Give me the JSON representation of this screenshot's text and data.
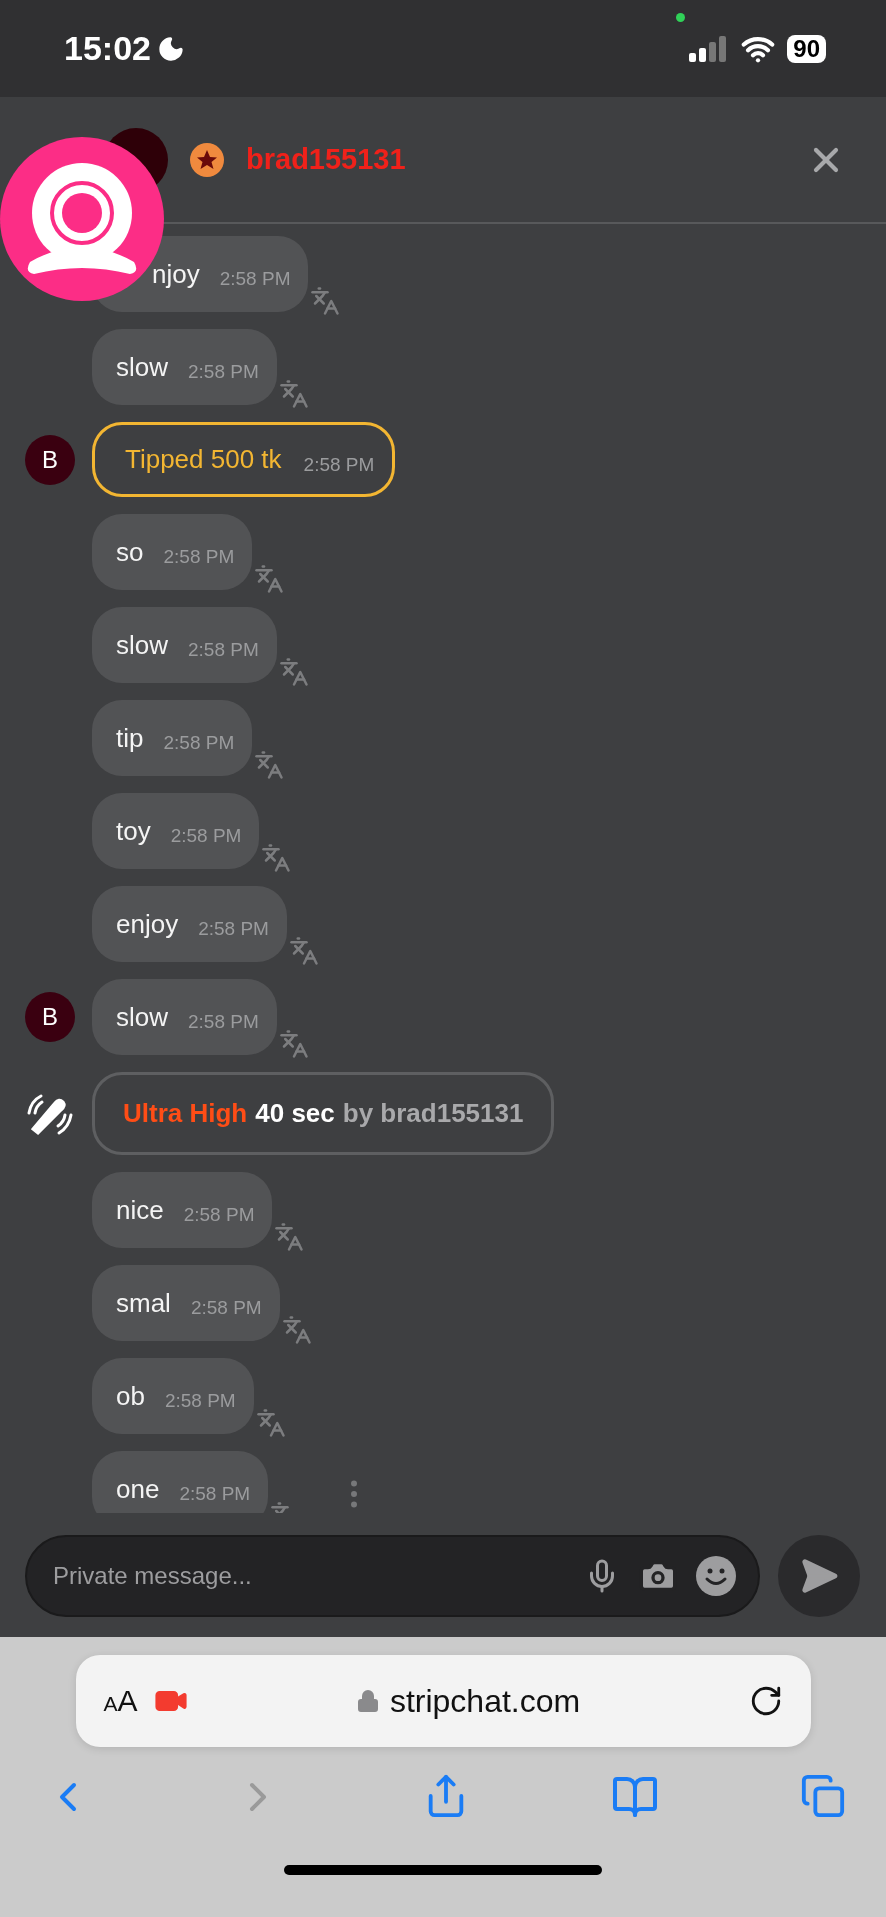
{
  "status_bar": {
    "time": "15:02",
    "battery": "90"
  },
  "chat_header": {
    "username": "brad155131"
  },
  "messages": [
    {
      "kind": "text",
      "text": "njoy",
      "time": "2:58 PM",
      "partly_covered": true
    },
    {
      "kind": "text",
      "text": "slow",
      "time": "2:58 PM"
    },
    {
      "kind": "tip",
      "text": "Tipped 500 tk",
      "time": "2:58 PM",
      "avatar": "B"
    },
    {
      "kind": "text",
      "text": "so",
      "time": "2:58 PM"
    },
    {
      "kind": "text",
      "text": "slow",
      "time": "2:58 PM"
    },
    {
      "kind": "text",
      "text": "tip",
      "time": "2:58 PM"
    },
    {
      "kind": "text",
      "text": "toy",
      "time": "2:58 PM"
    },
    {
      "kind": "text",
      "text": "enjoy",
      "time": "2:58 PM"
    },
    {
      "kind": "text",
      "text": "slow",
      "time": "2:58 PM",
      "avatar": "B"
    },
    {
      "kind": "vibe",
      "level_label": "Ultra High",
      "duration": "40 sec",
      "by": "by brad155131"
    },
    {
      "kind": "text",
      "text": "nice",
      "time": "2:58 PM"
    },
    {
      "kind": "text",
      "text": "smal",
      "time": "2:58 PM"
    },
    {
      "kind": "text",
      "text": "ob",
      "time": "2:58 PM"
    },
    {
      "kind": "text",
      "text": "one",
      "time": "2:58 PM"
    }
  ],
  "composer": {
    "placeholder": "Private message..."
  },
  "browser": {
    "text_size": "AA",
    "url": "stripchat.com",
    "back_disabled": false,
    "forward_disabled": true
  }
}
